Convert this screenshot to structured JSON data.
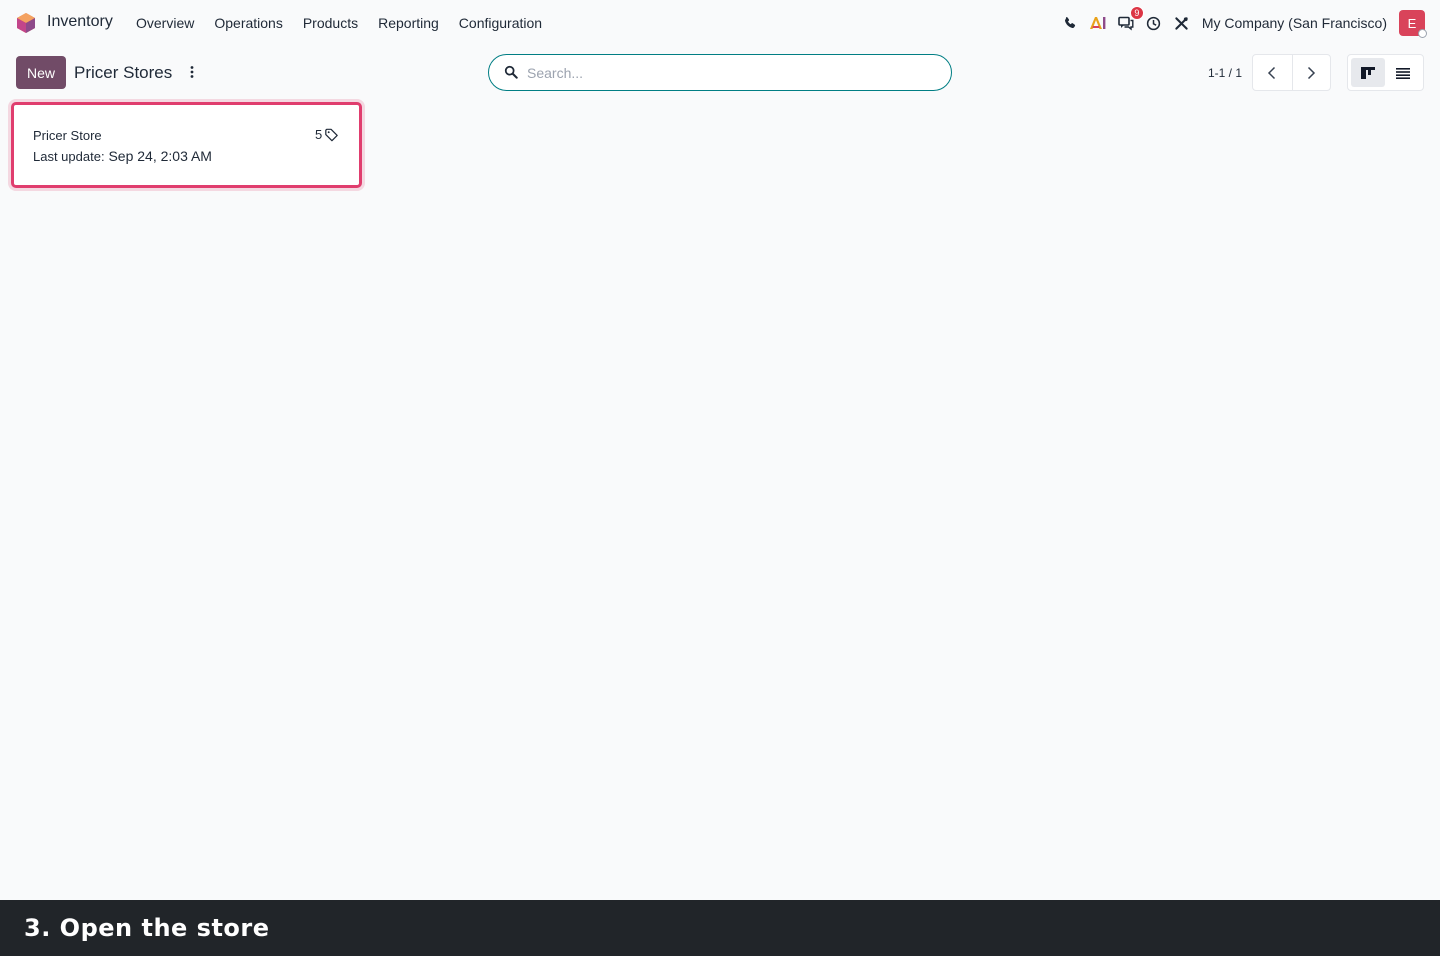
{
  "topbar": {
    "app_name": "Inventory",
    "menu": [
      "Overview",
      "Operations",
      "Products",
      "Reporting",
      "Configuration"
    ],
    "chat_badge": "9",
    "company": "My Company (San Francisco)",
    "avatar_initial": "E"
  },
  "control_panel": {
    "new_label": "New",
    "title": "Pricer Stores",
    "search_placeholder": "Search...",
    "pager_value": "1-1 / 1"
  },
  "cards": [
    {
      "name": "Pricer Store",
      "last_update_label": "Last update:",
      "last_update_value": "Sep 24, 2:03 AM",
      "tag_count": "5"
    }
  ],
  "caption": "3. Open the store",
  "colors": {
    "brand": "#714b67",
    "search_border": "#017e84",
    "card_highlight": "#e03d6e",
    "avatar": "#d9435a",
    "caption_bg": "#212529"
  }
}
